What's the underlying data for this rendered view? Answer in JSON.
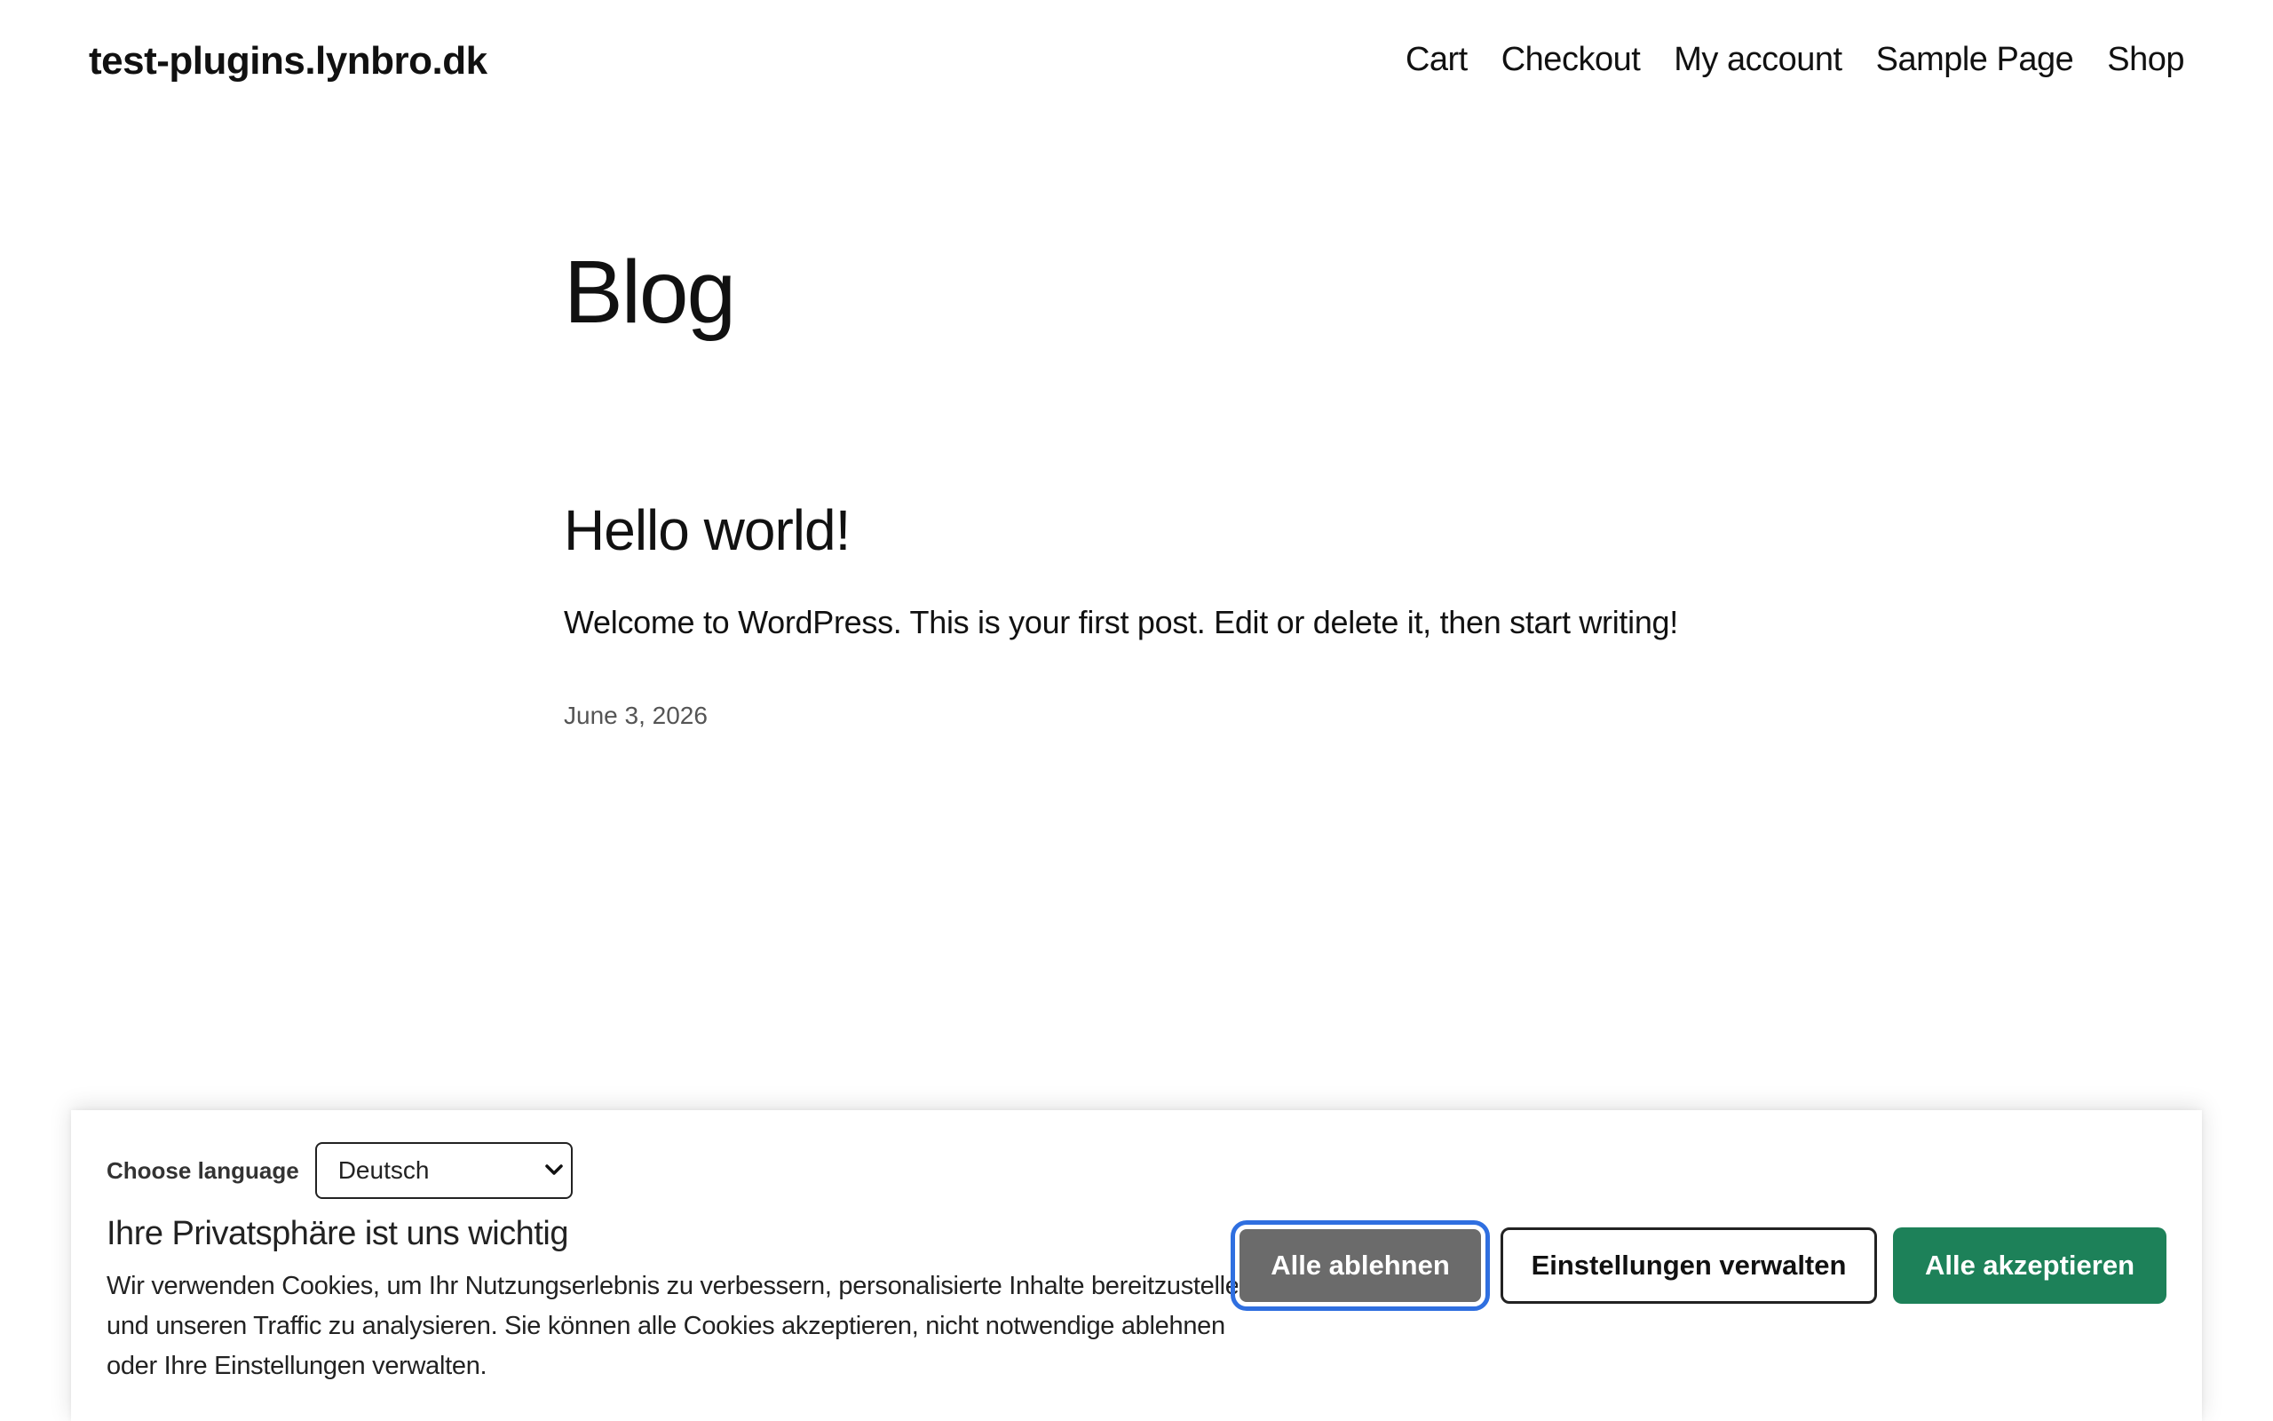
{
  "header": {
    "site_title": "test-plugins.lynbro.dk",
    "nav": [
      "Cart",
      "Checkout",
      "My account",
      "Sample Page",
      "Shop"
    ]
  },
  "main": {
    "page_heading": "Blog",
    "post": {
      "title": "Hello world!",
      "excerpt": "Welcome to WordPress. This is your first post. Edit or delete it, then start writing!",
      "date": "June 3, 2026"
    }
  },
  "cookie_banner": {
    "language_label": "Choose language",
    "language_selected": "Deutsch",
    "title": "Ihre Privatsphäre ist uns wichtig",
    "text": "Wir verwenden Cookies, um Ihr Nutzungserlebnis zu verbessern, personalisierte Inhalte bereitzustellen und unseren Traffic zu analysieren. Sie können alle Cookies akzeptieren, nicht notwendige ablehnen oder Ihre Einstellungen verwalten.",
    "buttons": {
      "reject": "Alle ablehnen",
      "settings": "Einstellungen verwalten",
      "accept": "Alle akzeptieren"
    }
  },
  "colors": {
    "accept": "#1d8159",
    "reject": "#6b6b6b",
    "focus_ring": "#2f6fe0"
  },
  "icons": {
    "select": "chevron-down-icon"
  }
}
